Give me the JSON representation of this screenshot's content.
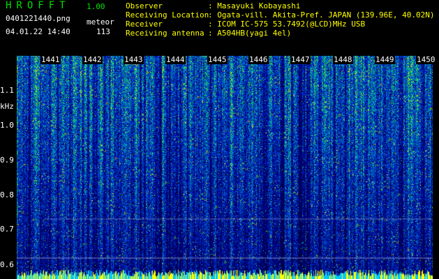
{
  "app": {
    "name": "HROFFT",
    "version": "1.00"
  },
  "file": {
    "name": "0401221440.png",
    "datetime": "04.01.22 14:40"
  },
  "meteor": {
    "label": "meteor",
    "count": "113"
  },
  "info": [
    {
      "key": "Observer",
      "value": ": Masayuki Kobayashi"
    },
    {
      "key": "Receiving Location",
      "value": ": Ogata-vill. Akita-Pref. JAPAN (139.96E, 40.02N)"
    },
    {
      "key": "Receiver",
      "value": ": ICOM IC-575 53.7492(@LCD)MHz USB"
    },
    {
      "key": "Receiving antenna",
      "value": ": A504HB(yagi 4el)"
    }
  ],
  "axes": {
    "unit": "kHz",
    "time_ticks": [
      "1441",
      "1442",
      "1443",
      "1444",
      "1445",
      "1446",
      "1447",
      "1448",
      "1449",
      "1450"
    ],
    "freq_ticks": [
      "1.1",
      "1.0",
      "0.9",
      "0.8",
      "0.7",
      "0.6"
    ]
  },
  "colors": {
    "background": "#000000",
    "app_name": "#00e000",
    "info_text": "#ffff00",
    "axis_text": "#ffffff"
  }
}
